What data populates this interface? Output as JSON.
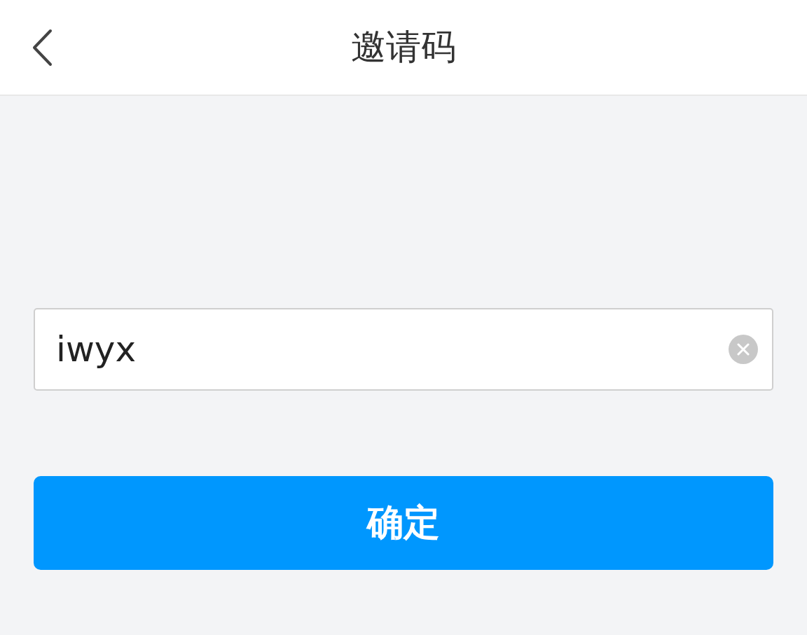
{
  "header": {
    "title": "邀请码"
  },
  "field": {
    "value": "iwyx"
  },
  "button": {
    "label": "确定"
  }
}
